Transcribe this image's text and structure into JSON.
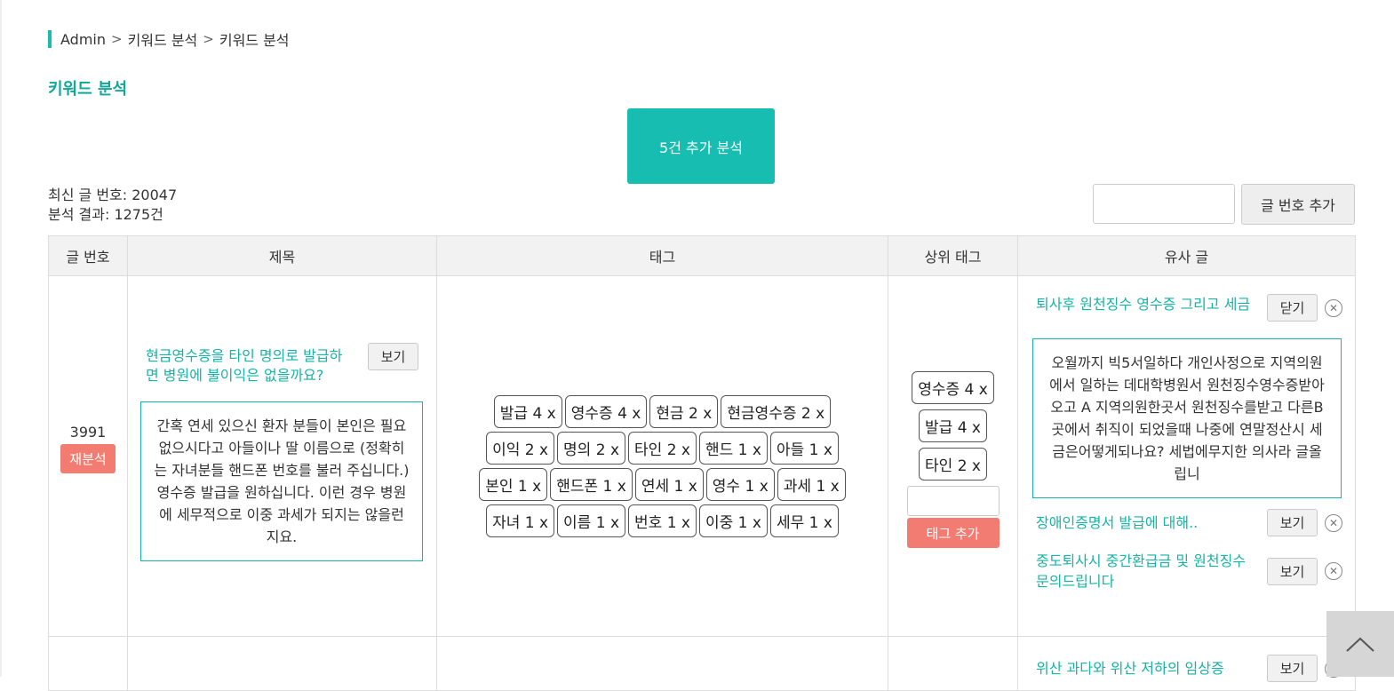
{
  "breadcrumb": {
    "items": [
      "Admin",
      "키워드 분석",
      "키워드 분석"
    ],
    "separator": ">"
  },
  "page_title": "키워드 분석",
  "analyze_button": "5건 추가 분석",
  "info": {
    "latest": "최신 글 번호: 20047",
    "result": "분석 결과: 1275건"
  },
  "add_post_button": "글 번호 추가",
  "table": {
    "headers": [
      "글 번호",
      "제목",
      "태그",
      "상위 태그",
      "유사 글"
    ],
    "rows": [
      {
        "post_number": "3991",
        "reanalyze": "재분석",
        "title": "현금영수증을 타인 명의로 발급하면 병원에 불이익은 없을까요?",
        "view": "보기",
        "content": "간혹 연세 있으신 환자 분들이 본인은 필요 없으시다고 아들이나 딸 이름으로 (정확히는 자녀분들 핸드폰 번호를 불러 주십니다.) 영수증 발급을 원하십니다. 이런 경우 병원에 세무적으로 이중 과세가 되지는 않을런지요.",
        "tags": [
          "발급 4 x",
          "영수증 4 x",
          "현금 2 x",
          "현금영수증 2 x",
          "이익 2 x",
          "명의 2 x",
          "타인 2 x",
          "핸드 1 x",
          "아들 1 x",
          "본인 1 x",
          "핸드폰 1 x",
          "연세 1 x",
          "영수 1 x",
          "과세 1 x",
          "자녀 1 x",
          "이름 1 x",
          "번호 1 x",
          "이중 1 x",
          "세무 1 x"
        ],
        "top_tags": [
          "영수증 4 x",
          "발급 4 x",
          "타인 2 x"
        ],
        "add_tag": "태그 추가",
        "similar": [
          {
            "title": "퇴사후 원천징수 영수증 그리고 세금",
            "button": "닫기",
            "expanded": "오월까지 빅5서일하다 개인사정으로 지역의원에서 일하는 데대학병원서 원천징수영수증받아오고 A 지역의원한곳서 원천징수를받고 다른B곳에서 취직이 되었을때 나중에 연말정산시 세금은어떻게되나요? 세법에무지한 의사라 글올립니"
          },
          {
            "title": "장애인증명서 발급에 대해..",
            "button": "보기"
          },
          {
            "title": "중도퇴사시 중간환급금 및 원천징수 문의드립니다",
            "button": "보기"
          }
        ]
      }
    ],
    "next_row_similar": {
      "title": "위산 과다와 위산 저하의 임상증",
      "button": "보기"
    }
  },
  "icons": {
    "remove": "close-circle-icon",
    "scroll": "chevron-up-icon"
  },
  "colors": {
    "accent": "#16bdb0",
    "danger": "#f37c72"
  }
}
